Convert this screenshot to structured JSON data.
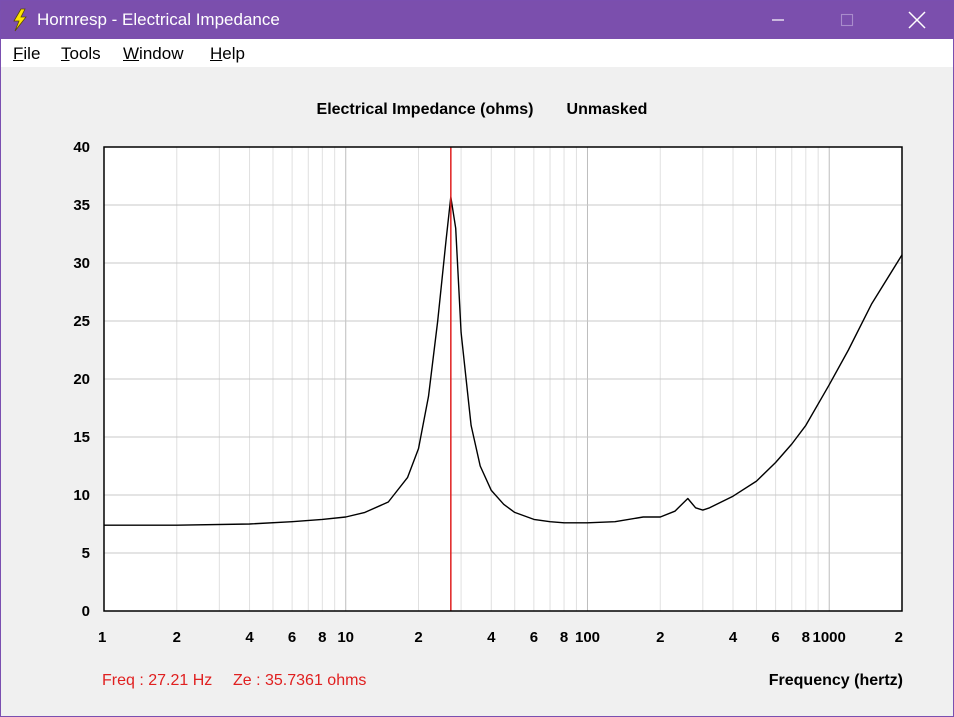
{
  "window": {
    "title": "Hornresp - Electrical Impedance",
    "titlebar_color": "#7b4fad"
  },
  "menu": {
    "items": [
      {
        "label": "File",
        "mnemonic": "F",
        "rest": "ile"
      },
      {
        "label": "Tools",
        "mnemonic": "T",
        "rest": "ools"
      },
      {
        "label": "Window",
        "mnemonic": "W",
        "rest": "indow"
      },
      {
        "label": "Help",
        "mnemonic": "H",
        "rest": "elp"
      }
    ]
  },
  "chart": {
    "title": "Electrical Impedance (ohms)",
    "mask_state": "Unmasked",
    "xlabel": "Frequency (hertz)",
    "cursor_readout": {
      "freq": "Freq : 27.21 Hz",
      "ze": "Ze : 35.7361 ohms"
    },
    "x_tick_labels": [
      {
        "value": 1,
        "label": "1"
      },
      {
        "value": 2,
        "label": "2"
      },
      {
        "value": 4,
        "label": "4"
      },
      {
        "value": 6,
        "label": "6"
      },
      {
        "value": 8,
        "label": "8"
      },
      {
        "value": 10,
        "label": "10"
      },
      {
        "value": 20,
        "label": "2"
      },
      {
        "value": 40,
        "label": "4"
      },
      {
        "value": 60,
        "label": "6"
      },
      {
        "value": 80,
        "label": "8"
      },
      {
        "value": 100,
        "label": "100"
      },
      {
        "value": 200,
        "label": "2"
      },
      {
        "value": 400,
        "label": "4"
      },
      {
        "value": 600,
        "label": "6"
      },
      {
        "value": 800,
        "label": "8"
      },
      {
        "value": 1000,
        "label": "1000"
      },
      {
        "value": 2000,
        "label": "2"
      }
    ],
    "y_tick_labels": [
      "0",
      "5",
      "10",
      "15",
      "20",
      "25",
      "30",
      "35",
      "40"
    ],
    "colors": {
      "curve": "#000000",
      "cursor": "#e02020",
      "readout": "#e02020",
      "grid": "#c8c8c8",
      "plot_bg": "#ffffff"
    }
  },
  "chart_data": {
    "type": "line",
    "title": "Electrical Impedance (ohms)",
    "xlabel": "Frequency (hertz)",
    "ylabel": "",
    "x_scale": "log",
    "xlim": [
      1,
      2000
    ],
    "ylim": [
      0,
      40
    ],
    "grid": true,
    "cursor": {
      "x": 27.21,
      "y": 35.7361
    },
    "series": [
      {
        "x": [
          1,
          2,
          4,
          6,
          8,
          10,
          12,
          15,
          18,
          20,
          22,
          24,
          26,
          27.21,
          28.5,
          30,
          33,
          36,
          40,
          45,
          50,
          60,
          70,
          80,
          100,
          130,
          170,
          200,
          230,
          260,
          280,
          300,
          320,
          350,
          400,
          500,
          600,
          700,
          800,
          1000,
          1200,
          1500,
          2000
        ],
        "y": [
          7.4,
          7.4,
          7.5,
          7.7,
          7.9,
          8.1,
          8.5,
          9.4,
          11.5,
          14.0,
          18.5,
          25.0,
          32.0,
          35.7,
          33.0,
          24.0,
          16.0,
          12.5,
          10.4,
          9.2,
          8.5,
          7.9,
          7.7,
          7.6,
          7.6,
          7.7,
          8.1,
          8.1,
          8.6,
          9.7,
          8.9,
          8.7,
          8.9,
          9.3,
          9.9,
          11.2,
          12.8,
          14.4,
          16.0,
          19.5,
          22.5,
          26.5,
          30.7
        ]
      }
    ]
  }
}
